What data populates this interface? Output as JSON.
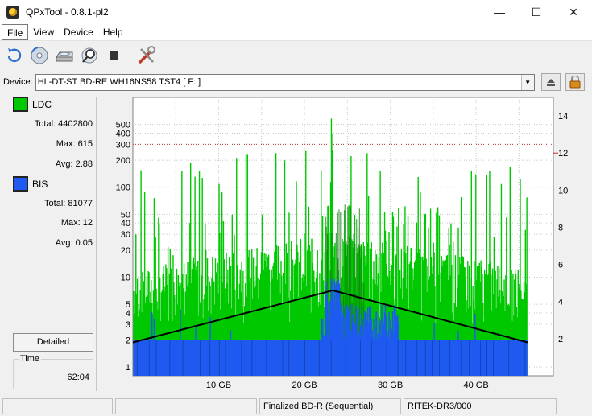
{
  "window": {
    "title": "QPxTool - 0.8.1-pl2"
  },
  "window_controls": {
    "minimize": "—",
    "maximize": "☐",
    "close": "✕"
  },
  "menu": [
    "File",
    "View",
    "Device",
    "Help"
  ],
  "toolbar": {
    "icons": [
      "refresh-icon",
      "disc-scan-icon",
      "drive-icon",
      "magnify-icon",
      "stop-icon",
      "settings-tools-icon"
    ]
  },
  "device": {
    "label": "Device:",
    "value": "HL-DT-ST BD-RE  WH16NS58  TST4 [ F: ]"
  },
  "stats": {
    "ldc": {
      "name": "LDC",
      "color": "#00c800",
      "total_label": "Total:",
      "total": "4402800",
      "max_label": "Max:",
      "max": "615",
      "avg_label": "Avg:",
      "avg": "2.88"
    },
    "bis": {
      "name": "BIS",
      "color": "#1e5af0",
      "total_label": "Total:",
      "total": "81077",
      "max_label": "Max:",
      "max": "12",
      "avg_label": "Avg:",
      "avg": "0.05"
    }
  },
  "detailed_label": "Detailed",
  "time": {
    "label": "Time",
    "value": "62:04"
  },
  "status": {
    "cell1": "",
    "cell2": "",
    "disc_type": "Finalized BD-R (Sequential)",
    "media_id": "RITEK-DR3/000"
  },
  "chart_data": {
    "type": "bar",
    "x_tick_labels": [
      "10 GB",
      "20 GB",
      "30 GB",
      "40 GB"
    ],
    "x_ticks": [
      10,
      20,
      30,
      40
    ],
    "xlim": [
      0,
      49
    ],
    "data_end": 46,
    "left_scale": "log",
    "left_ticks": [
      1,
      2,
      3,
      4,
      5,
      10,
      20,
      30,
      40,
      50,
      100,
      200,
      300,
      400,
      500
    ],
    "left_ylim": [
      0.8,
      1000
    ],
    "right_ticks": [
      2,
      4,
      6,
      8,
      10,
      12,
      14
    ],
    "right_ylim": [
      0,
      15
    ],
    "grid": true,
    "series": [
      {
        "name": "LDC",
        "color": "#00c800",
        "typical_range": [
          3,
          40
        ],
        "max": 615
      },
      {
        "name": "BIS",
        "color": "#1e5af0",
        "typical": 2,
        "max": 12
      },
      {
        "speed_color": "#000000",
        "x": [
          0,
          23.3,
          46
        ],
        "y": [
          1.8,
          4.6,
          1.8
        ]
      }
    ],
    "red_lines_left": [
      300
    ],
    "red_lines_right": [
      12
    ]
  }
}
